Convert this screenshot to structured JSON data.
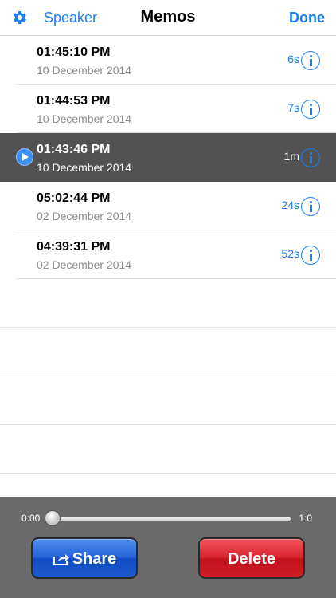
{
  "navbar": {
    "left_label": "Speaker",
    "title": "Memos",
    "right_label": "Done",
    "settings_icon": "gear-icon"
  },
  "memos": [
    {
      "time": "01:45:10 PM",
      "date": "10 December 2014",
      "duration": "6s",
      "selected": false
    },
    {
      "time": "01:44:53 PM",
      "date": "10 December 2014",
      "duration": "7s",
      "selected": false
    },
    {
      "time": "01:43:46 PM",
      "date": "10 December 2014",
      "duration": "1m",
      "selected": true
    },
    {
      "time": "05:02:44 PM",
      "date": "02 December 2014",
      "duration": "24s",
      "selected": false
    },
    {
      "time": "04:39:31 PM",
      "date": "02 December 2014",
      "duration": "52s",
      "selected": false
    }
  ],
  "player": {
    "time_start": "0:00",
    "time_end": "1:0",
    "progress": 0.0
  },
  "buttons": {
    "share_label": "Share",
    "delete_label": "Delete"
  },
  "colors": {
    "accent": "#1a7ff2",
    "selected_row": "#525252",
    "player_bg": "#6b6b6b",
    "share": "#1e5bd0",
    "delete": "#d11d26"
  }
}
